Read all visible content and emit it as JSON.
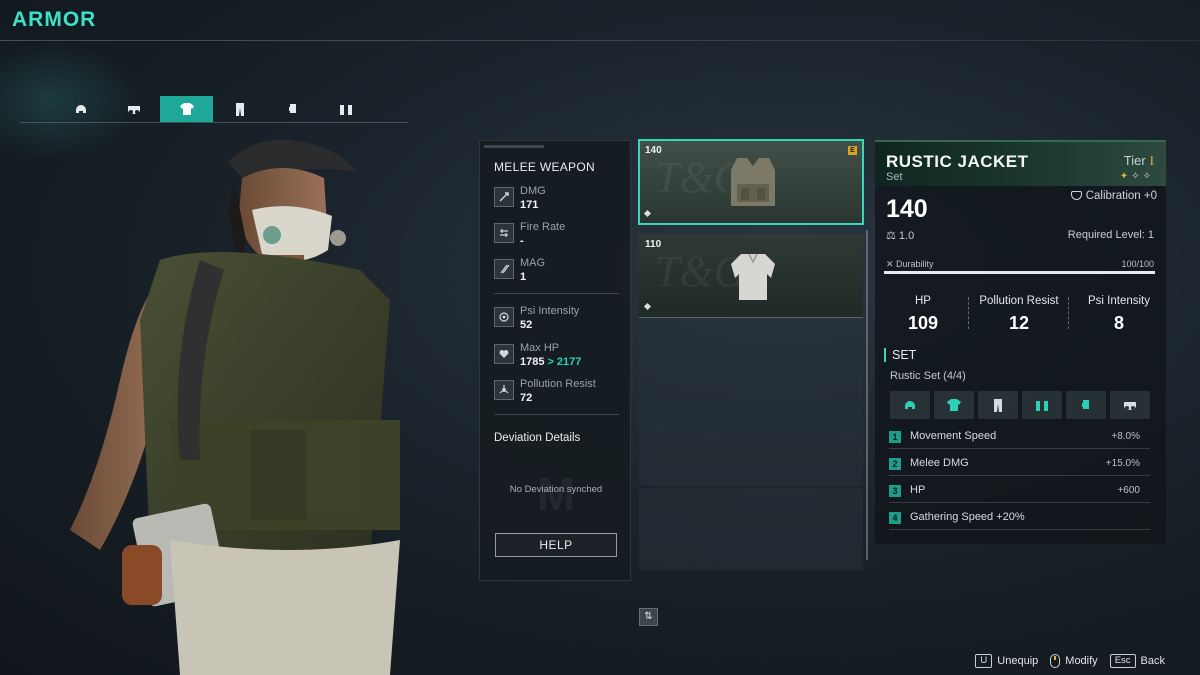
{
  "screen": {
    "title": "ARMOR"
  },
  "slot_tabs": [
    {
      "icon": "helmet-icon",
      "active": false
    },
    {
      "icon": "mask-icon",
      "active": false
    },
    {
      "icon": "jacket-icon",
      "active": true
    },
    {
      "icon": "pants-icon",
      "active": false
    },
    {
      "icon": "gloves-icon",
      "active": false
    },
    {
      "icon": "boots-icon",
      "active": false
    }
  ],
  "stats_panel": {
    "weapon_title": "MELEE WEAPON",
    "stats": [
      {
        "label": "DMG",
        "value": "171",
        "icon": "dmg-icon"
      },
      {
        "label": "Fire Rate",
        "value": "-",
        "icon": "fire-rate-icon"
      },
      {
        "label": "MAG",
        "value": "1",
        "icon": "mag-icon"
      },
      {
        "label": "Psi Intensity",
        "value": "52",
        "icon": "psi-icon"
      },
      {
        "label": "Max HP",
        "value": "1785",
        "next_value": "2177",
        "arrow": ">",
        "icon": "heart-icon"
      },
      {
        "label": "Pollution Resist",
        "value": "72",
        "icon": "pollution-icon"
      }
    ],
    "deviation_title": "Deviation Details",
    "deviation_message": "No Deviation synched",
    "help_label": "HELP"
  },
  "item_list": [
    {
      "power": "140",
      "selected": true,
      "equipped_badge": "E",
      "item": "tactical-vest"
    },
    {
      "power": "110",
      "selected": false,
      "item": "white-jacket"
    }
  ],
  "detail": {
    "name": "RUSTIC JACKET",
    "type": "Set",
    "tier_label": "Tier",
    "tier_roman": "I",
    "tier_stars_lit": 1,
    "tier_stars_total": 3,
    "calibration": "Calibration +0",
    "power": "140",
    "weight": "1.0",
    "required_level": "Required Level: 1",
    "durability_label": "Durability",
    "durability_value": "100/100",
    "durability_fraction": 1.0,
    "attributes": [
      {
        "label": "HP",
        "value": "109"
      },
      {
        "label": "Pollution Resist",
        "value": "12"
      },
      {
        "label": "Psi Intensity",
        "value": "8"
      }
    ],
    "set_title": "SET",
    "set_name": "Rustic Set (4/4)",
    "set_pieces": [
      {
        "icon": "helmet-icon",
        "owned": true
      },
      {
        "icon": "jacket-icon",
        "owned": true
      },
      {
        "icon": "pants-icon",
        "owned": false
      },
      {
        "icon": "boots-icon",
        "owned": true
      },
      {
        "icon": "gloves-icon",
        "owned": true
      },
      {
        "icon": "mask-icon",
        "owned": false
      }
    ],
    "set_bonuses": [
      {
        "num": "1",
        "name": "Movement Speed",
        "value": "+8.0%"
      },
      {
        "num": "2",
        "name": "Melee DMG",
        "value": "+15.0%"
      },
      {
        "num": "3",
        "name": "HP",
        "value": "+600"
      },
      {
        "num": "4",
        "name": "Gathering Speed +20%",
        "value": ""
      }
    ]
  },
  "footer": {
    "unequip_key": "U",
    "unequip_label": "Unequip",
    "modify_label": "Modify",
    "back_key": "Esc",
    "back_label": "Back"
  },
  "colors": {
    "accent": "#3fe0c8",
    "teal": "#1ea89a",
    "tier_gold": "#e0b23a"
  }
}
